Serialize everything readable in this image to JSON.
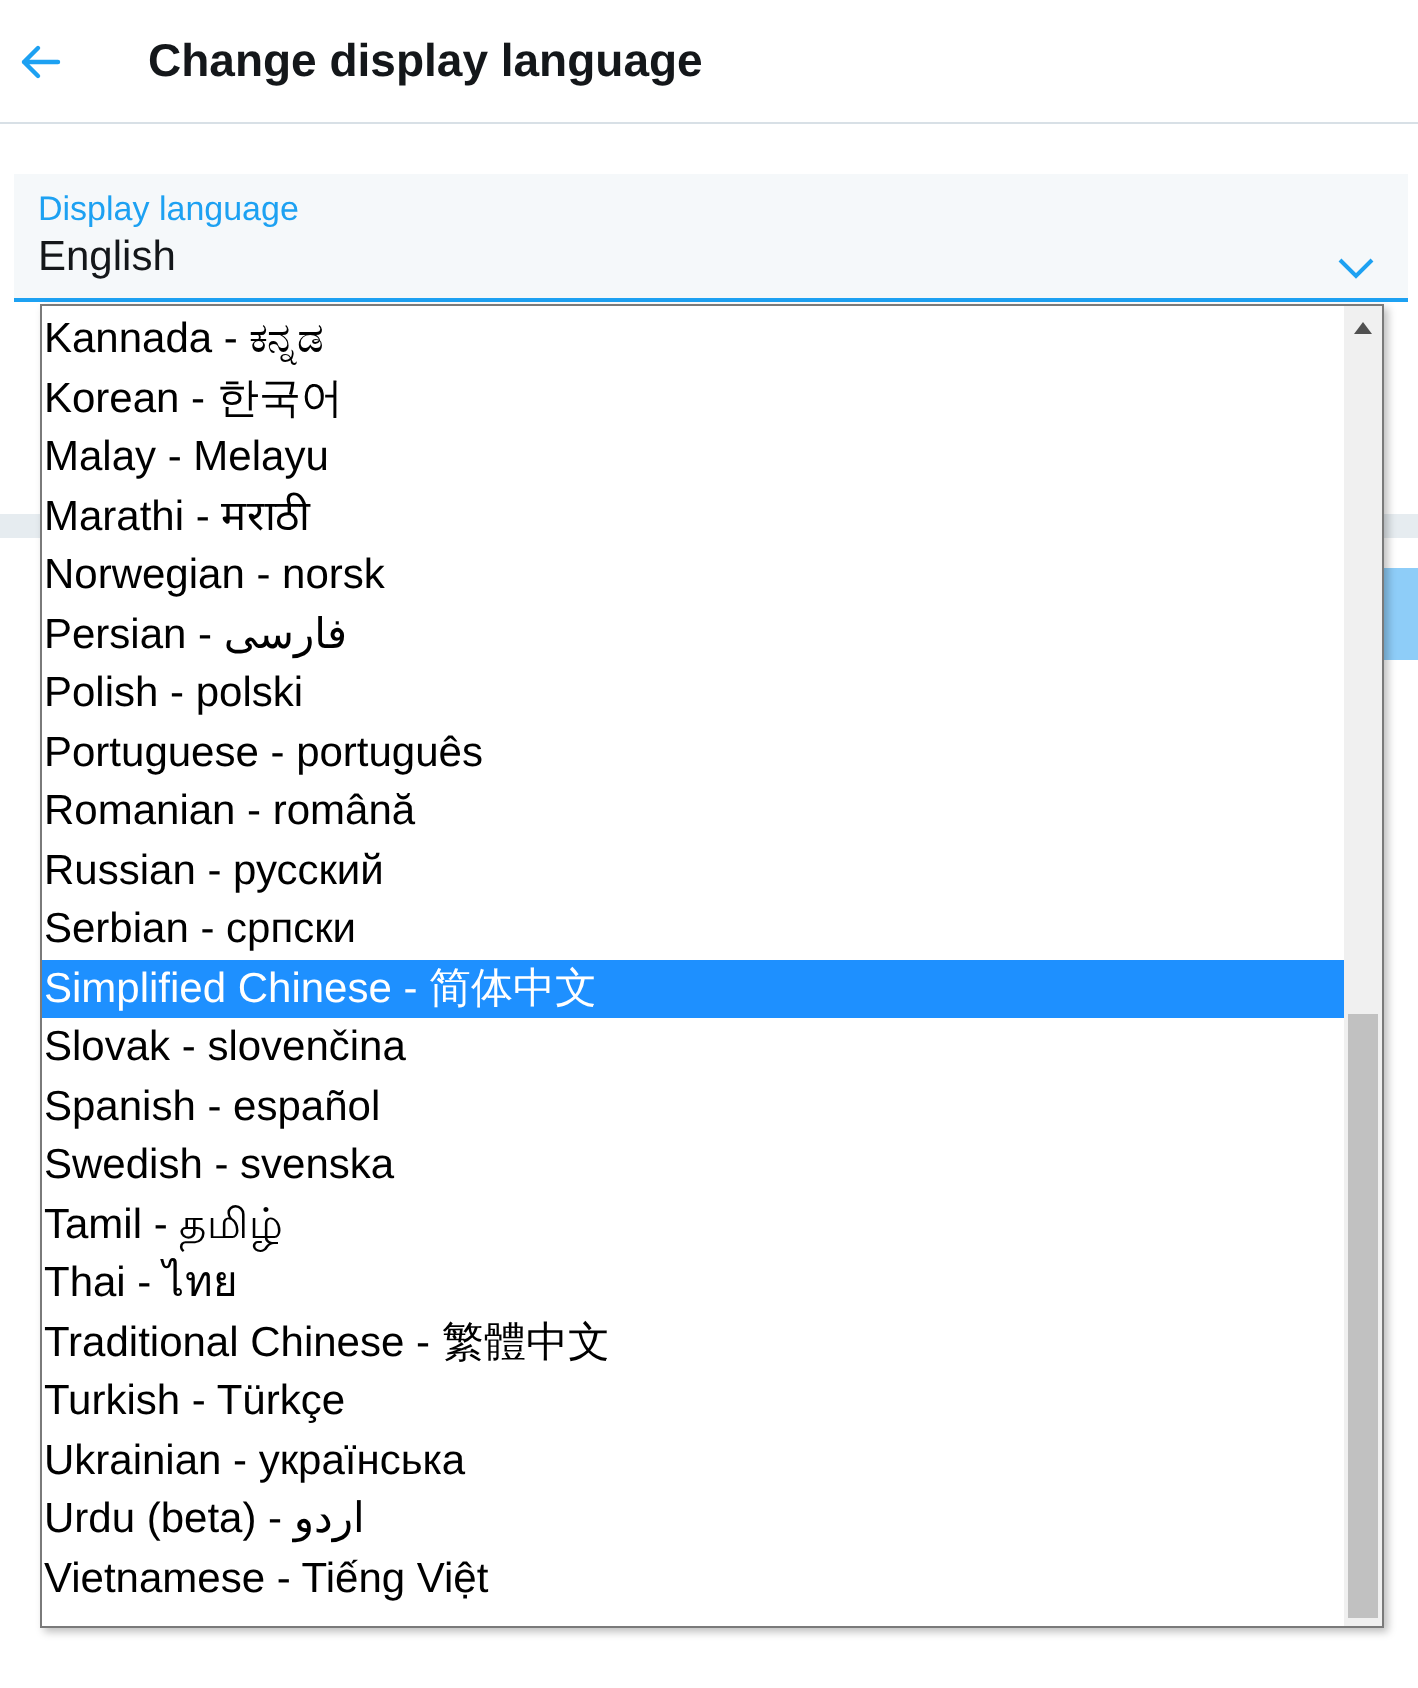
{
  "header": {
    "title": "Change display language"
  },
  "field": {
    "label": "Display language",
    "value": "English"
  },
  "options": [
    {
      "label": "Kannada - ಕನ್ನಡ",
      "selected": false
    },
    {
      "label": "Korean - 한국어",
      "selected": false
    },
    {
      "label": "Malay - Melayu",
      "selected": false
    },
    {
      "label": "Marathi - मराठी",
      "selected": false
    },
    {
      "label": "Norwegian - norsk",
      "selected": false
    },
    {
      "label": "Persian - فارسی",
      "selected": false
    },
    {
      "label": "Polish - polski",
      "selected": false
    },
    {
      "label": "Portuguese - português",
      "selected": false
    },
    {
      "label": "Romanian - română",
      "selected": false
    },
    {
      "label": "Russian - русский",
      "selected": false
    },
    {
      "label": "Serbian - српски",
      "selected": false
    },
    {
      "label": "Simplified Chinese - 简体中文",
      "selected": true
    },
    {
      "label": "Slovak - slovenčina",
      "selected": false
    },
    {
      "label": "Spanish - español",
      "selected": false
    },
    {
      "label": "Swedish - svenska",
      "selected": false
    },
    {
      "label": "Tamil - தமிழ்",
      "selected": false
    },
    {
      "label": "Thai - ไทย",
      "selected": false
    },
    {
      "label": "Traditional Chinese - 繁體中文",
      "selected": false
    },
    {
      "label": "Turkish - Türkçe",
      "selected": false
    },
    {
      "label": "Ukrainian - українська",
      "selected": false
    },
    {
      "label": "Urdu (beta) - اردو",
      "selected": false
    },
    {
      "label": "Vietnamese - Tiếng Việt",
      "selected": false
    }
  ]
}
